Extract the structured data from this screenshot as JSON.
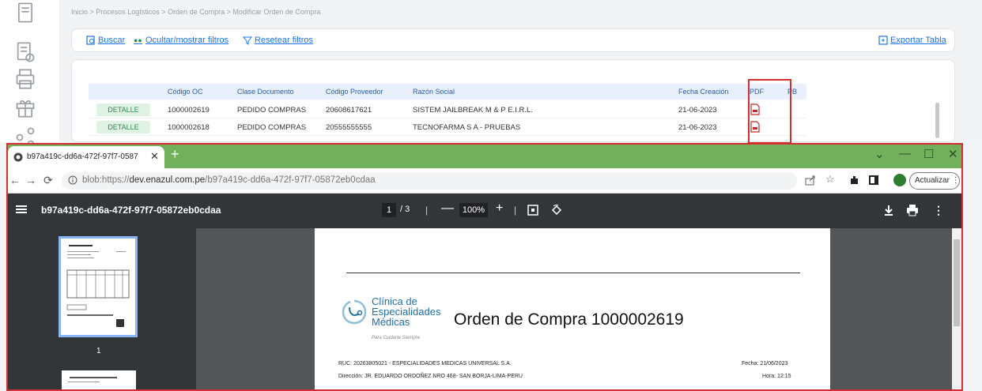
{
  "breadcrumb": "Inicio > Procesos Logísticos > Orden de Compra > Modificar Orden de Compra",
  "toolbar": {
    "buscar": "Buscar",
    "ocultar": "Ocultar/mostrar filtros",
    "resetear": "Resetear filtros",
    "exportar": "Exportar Tabla"
  },
  "table": {
    "headers": [
      "Código OC",
      "Clase Documento",
      "Código Proveedor",
      "Razón Social",
      "Fecha Creación",
      "PDF",
      "PB"
    ],
    "detail_label": "DETALLE",
    "rows": [
      {
        "codigo_oc": "1000002619",
        "clase": "PEDIDO COMPRAS",
        "proveedor": "20608617621",
        "razon": "SISTEM JAILBREAK M & P E.I.R.L.",
        "fecha": "21-06-2023"
      },
      {
        "codigo_oc": "1000002618",
        "clase": "PEDIDO COMPRAS",
        "proveedor": "20555555555",
        "razon": "TECNOFARMA S A - PRUEBAS",
        "fecha": "21-06-2023"
      }
    ]
  },
  "browser": {
    "tab_title": "b97a419c-dd6a-472f-97f7-0587",
    "url_prefix": "blob:https://",
    "url_host": "dev.enazul.com.pe",
    "url_path": "/b97a419c-dd6a-472f-97f7-05872eb0cdaa",
    "update_label": "Actualizar",
    "win_minimize": "—",
    "win_maximize": "☐",
    "win_close": "✕",
    "collapse": "⌄"
  },
  "pdf_viewer": {
    "doc_name": "b97a419c-dd6a-472f-97f7-05872eb0cdaa",
    "current_page": "1",
    "total_pages": "/ 3",
    "zoom": "100%",
    "thumb_page": "1"
  },
  "document": {
    "logo_line1": "Clínica de",
    "logo_line2": "Especialidades",
    "logo_line3": "Médicas",
    "logo_tagline": "Para Cuidarte Siempre",
    "title": "Orden de Compra 1000002619",
    "ruc": "RUC: 20263805021 - ESPECIALIDADES MEDICAS UNIVERSAL S.A.",
    "direccion": "Dirección: JR. EDUARDO ORDOÑEZ NRO 468- SAN BORJA-LIMA-PERU",
    "fecha": "Fecha: 21/06/2023",
    "hora": "Hora: 12:15"
  },
  "colors": {
    "accent_blue": "#1a73e8",
    "highlight_red": "#d32f2f",
    "tab_strip_green": "#72b05b",
    "detail_green": "#2e8b57",
    "pdf_toolbar": "#323639"
  }
}
